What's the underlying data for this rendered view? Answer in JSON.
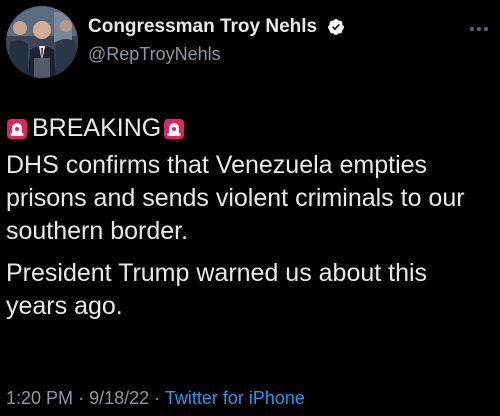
{
  "tweet": {
    "display_name": "Congressman Troy Nehls",
    "handle": "@RepTroyNehls",
    "breaking_label": "BREAKING",
    "paragraph_1": "DHS confirms that Venezuela empties prisons and sends violent criminals to our southern border.",
    "paragraph_2": "President Trump warned us about this years ago.",
    "time": "1:20 PM",
    "separator": "·",
    "date": "9/18/22",
    "source": "Twitter for iPhone"
  },
  "icons": {
    "verified": "verified-badge-icon",
    "siren": "police-siren-icon",
    "more": "more-options-icon"
  },
  "colors": {
    "background": "#000000",
    "text": "#e7e9ea",
    "secondary_text": "#8b98a5",
    "link": "#1d9bf0",
    "siren_red": "#e0245e"
  }
}
